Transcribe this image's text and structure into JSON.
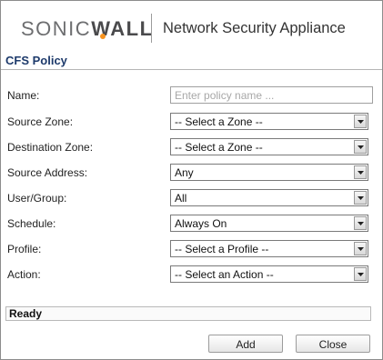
{
  "header": {
    "logo_light": "SONIC",
    "logo_bold": "WALL",
    "product": "Network Security Appliance"
  },
  "page": {
    "title": "CFS Policy"
  },
  "form": {
    "name": {
      "label": "Name:",
      "placeholder": "Enter policy name ...",
      "value": ""
    },
    "source_zone": {
      "label": "Source Zone:",
      "value": "-- Select a Zone --"
    },
    "destination_zone": {
      "label": "Destination Zone:",
      "value": "-- Select a Zone --"
    },
    "source_address": {
      "label": "Source Address:",
      "value": "Any"
    },
    "user_group": {
      "label": "User/Group:",
      "value": "All"
    },
    "schedule": {
      "label": "Schedule:",
      "value": "Always On"
    },
    "profile": {
      "label": "Profile:",
      "value": "-- Select a Profile --"
    },
    "action": {
      "label": "Action:",
      "value": "-- Select an Action --"
    }
  },
  "status": {
    "text": "Ready"
  },
  "buttons": {
    "add": "Add",
    "close": "Close"
  },
  "colors": {
    "accent": "#f7931e",
    "title": "#1d3a6b"
  }
}
